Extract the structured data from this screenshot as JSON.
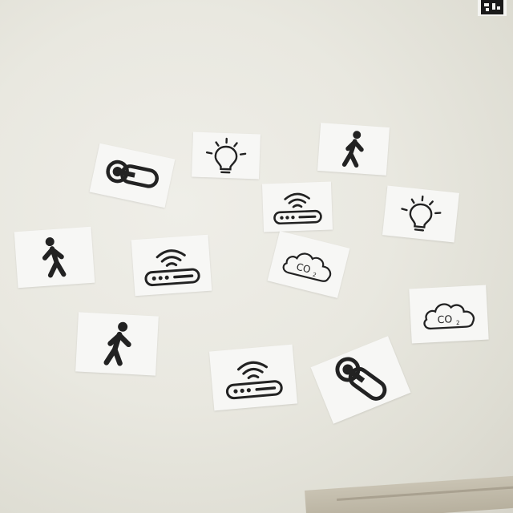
{
  "scene": {
    "description_icons": [
      "thermometer-icon",
      "light-bulb-icon",
      "walking-person-icon",
      "wifi-router-icon",
      "co2-cloud-icon"
    ],
    "co2_label": "CO",
    "co2_subscript": "2",
    "colors": {
      "background": "#e9e8e0",
      "card": "#f7f7f5",
      "icon": "#222222"
    }
  }
}
